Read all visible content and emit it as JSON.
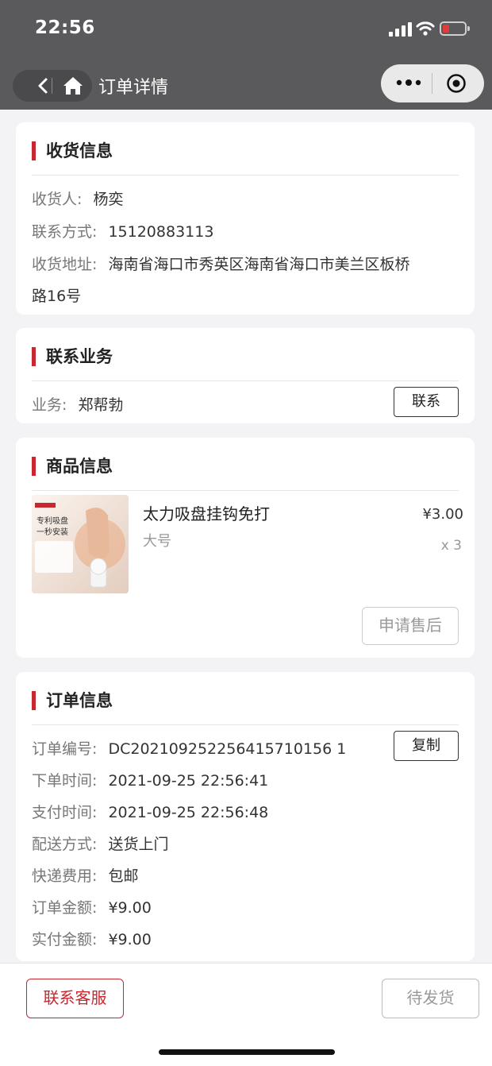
{
  "status_bar": {
    "time": "22:56"
  },
  "nav": {
    "title": "订单详情"
  },
  "shipping": {
    "title": "收货信息",
    "recipient_label": "收货人:",
    "recipient": "杨奕",
    "phone_label": "联系方式:",
    "phone": "15120883113",
    "address_label": "收货地址:",
    "address_line1": "海南省海口市秀英区海南省海口市美兰区板桥",
    "address_line2": "路16号"
  },
  "agent": {
    "title": "联系业务",
    "label": "业务:",
    "name": "郑帮勃",
    "contact_button": "联系"
  },
  "product": {
    "title": "商品信息",
    "name": "太力吸盘挂钩免打",
    "spec": "大号",
    "price": "¥3.00",
    "quantity": "x 3",
    "image_text_1": "专利吸盘",
    "image_text_2": "一秒安装",
    "after_sale_button": "申请售后"
  },
  "order": {
    "title": "订单信息",
    "number_label": "订单编号:",
    "number": "DC202109252256415710156 1",
    "copy_button": "复制",
    "order_time_label": "下单时间:",
    "order_time": "2021-09-25 22:56:41",
    "pay_time_label": "支付时间:",
    "pay_time": "2021-09-25 22:56:48",
    "delivery_label": "配送方式:",
    "delivery": "送货上门",
    "shipping_fee_label": "快递费用:",
    "shipping_fee": "包邮",
    "amount_label": "订单金额:",
    "amount": "¥9.00",
    "paid_label": "实付金额:",
    "paid": "¥9.00"
  },
  "bottom": {
    "service_button": "联系客服",
    "status_button": "待发货"
  },
  "colors": {
    "accent": "#c9272f",
    "nav_bg": "#5a5a5c",
    "page_bg": "#f3f2f4"
  }
}
